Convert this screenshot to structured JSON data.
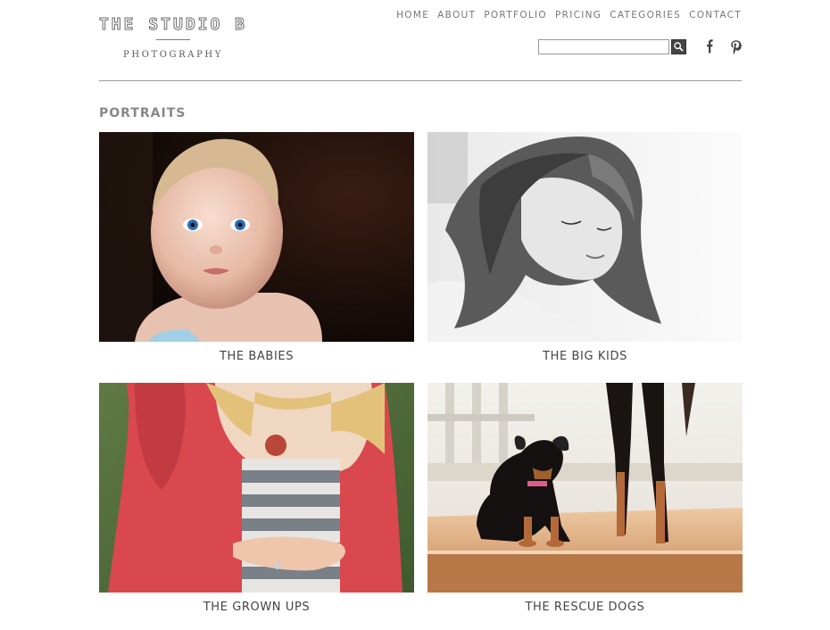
{
  "logo": {
    "title": "THE STUDIO B",
    "subtitle": "PHOTOGRAPHY"
  },
  "nav": {
    "items": [
      "HOME",
      "ABOUT",
      "PORTFOLIO",
      "PRICING",
      "CATEGORIES",
      "CONTACT"
    ]
  },
  "search": {
    "value": "",
    "placeholder": ""
  },
  "social": {
    "icons": [
      "facebook-icon",
      "pinterest-icon"
    ]
  },
  "section": {
    "title": "PORTRAITS"
  },
  "gallery": [
    {
      "caption": "THE BABIES",
      "image": "baby-portrait-photo"
    },
    {
      "caption": "THE BIG KIDS",
      "image": "girl-black-white-photo"
    },
    {
      "caption": "THE GROWN UPS",
      "image": "maternity-photo"
    },
    {
      "caption": "THE RESCUE DOGS",
      "image": "puppy-dog-photo"
    }
  ],
  "colors": {
    "nav_text": "#777777",
    "rule": "#999999",
    "caption": "#444444",
    "search_button": "#444444"
  }
}
